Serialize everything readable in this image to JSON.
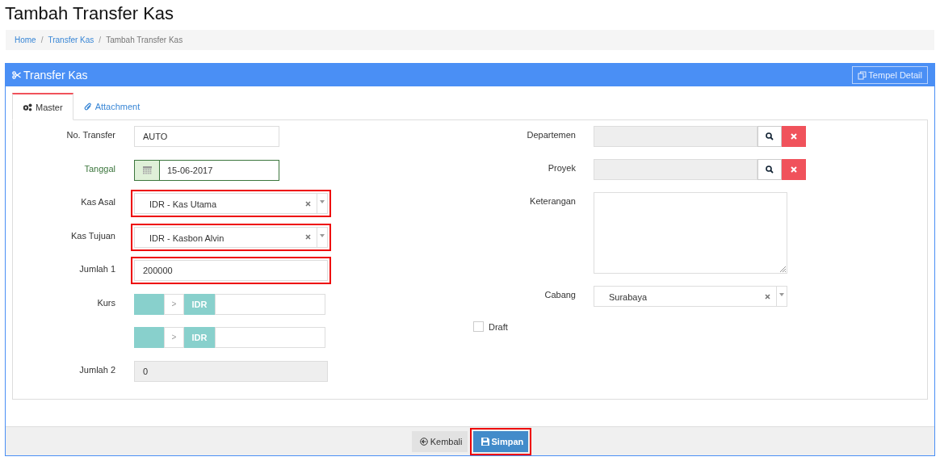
{
  "page_title": "Tambah Transfer Kas",
  "breadcrumb": [
    {
      "label": "Home",
      "kind": "link"
    },
    {
      "separator": "/",
      "label": "Transfer Kas",
      "kind": "link"
    },
    {
      "separator": "/",
      "label": "Tambah Transfer Kas",
      "kind": "current"
    }
  ],
  "panel": {
    "title": "Transfer Kas",
    "action": "Tempel Detail"
  },
  "tabs": [
    {
      "label": "Master",
      "selected": true
    },
    {
      "label": "Attachment",
      "selected": false
    }
  ],
  "left_fields": [
    {
      "kind": "text",
      "label": "No. Transfer",
      "value": "AUTO"
    },
    {
      "kind": "date",
      "label": "Tanggal",
      "value": "15-06-2017",
      "valid": true
    },
    {
      "kind": "select",
      "label": "Kas Asal",
      "value": "IDR - Kas Utama",
      "highlighted": true
    },
    {
      "kind": "select",
      "label": "Kas Tujuan",
      "value": "IDR - Kasbon Alvin",
      "highlighted": true
    },
    {
      "kind": "text",
      "label": "Jumlah 1",
      "value": "200000",
      "highlighted": true
    },
    {
      "kind": "rate",
      "label": "Kurs",
      "separator": ">",
      "currency": "IDR"
    },
    {
      "kind": "rate",
      "separator": ">",
      "currency": "IDR"
    },
    {
      "kind": "readonly",
      "label": "Jumlah 2",
      "value": "0"
    }
  ],
  "right_fields": [
    {
      "kind": "lookup",
      "label": "Departemen"
    },
    {
      "kind": "lookup",
      "label": "Proyek"
    },
    {
      "kind": "textarea",
      "label": "Keterangan"
    },
    {
      "kind": "select",
      "label": "Cabang",
      "value": "Surabaya"
    },
    {
      "kind": "checkbox",
      "label": "Draft",
      "checked": false
    }
  ],
  "buttons": [
    {
      "kind": "back",
      "label": "Kembali"
    },
    {
      "kind": "save",
      "label": "Simpan",
      "highlighted": true
    }
  ]
}
